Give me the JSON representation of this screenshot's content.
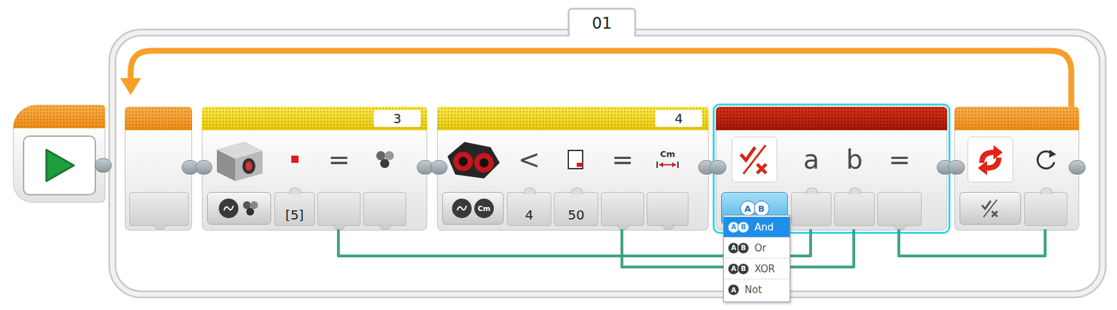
{
  "program": {
    "start": {
      "kind": "start"
    },
    "loop": {
      "name": "01",
      "blocks": [
        {
          "kind": "loop-start",
          "selected": false
        },
        {
          "kind": "color-sensor",
          "port": "3",
          "selected": false,
          "compare_symbol": "=",
          "inputs": [
            {
              "value": "[5]"
            }
          ]
        },
        {
          "kind": "ultrasonic-sensor",
          "port": "4",
          "selected": false,
          "operator": "<",
          "compare_symbol": "=",
          "unit": "Cm",
          "inputs": [
            {
              "value": "4"
            },
            {
              "value": "50"
            }
          ]
        },
        {
          "kind": "logic",
          "selected": true,
          "params": [
            "a",
            "b"
          ],
          "result_symbol": "=",
          "mode": "And"
        },
        {
          "kind": "loop-end",
          "selected": false
        }
      ]
    }
  },
  "mode_menu": {
    "open": true,
    "items": [
      {
        "label": "And",
        "letters": [
          "A",
          "B"
        ],
        "selected": true
      },
      {
        "label": "Or",
        "letters": [
          "A",
          "B"
        ],
        "selected": false
      },
      {
        "label": "XOR",
        "letters": [
          "A",
          "B"
        ],
        "selected": false
      },
      {
        "label": "Not",
        "letters": [
          "A"
        ],
        "selected": false
      }
    ]
  },
  "wires": [
    {
      "from": "color-sensor.result",
      "to": "logic.a"
    },
    {
      "from": "ultrasonic-sensor.result",
      "to": "logic.b"
    },
    {
      "from": "logic.result",
      "to": "loop-end.condition"
    }
  ]
}
